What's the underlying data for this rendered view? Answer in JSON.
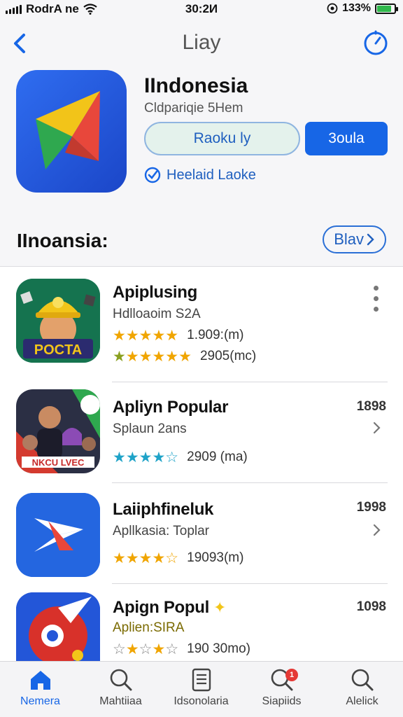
{
  "status_bar": {
    "carrier": "RodrA ne",
    "time": "30:2И",
    "battery": "133%"
  },
  "nav": {
    "title": "Liay"
  },
  "hero": {
    "name": "IIndonesia",
    "subtitle": "Cldpariqie 5Hem",
    "install_label": "Raoku ly",
    "open_label": "3oula",
    "verified_label": "Heelaid Laoke"
  },
  "section": {
    "title": "IInoansia:",
    "button_label": "Blav"
  },
  "apps": [
    {
      "name": "Apiplusing",
      "subtitle": "Hdlloaoim S2A",
      "rating_text_1": "1.909:(m)",
      "rating_text_2": "2905(mc)",
      "right_label": "",
      "stars_1": 5,
      "stars_2": 5
    },
    {
      "name": "Apliyn Popular",
      "subtitle": "Splaun 2ans",
      "rating_text_1": "2909 (ma)",
      "right_label": "1898",
      "stars_1": 4.5
    },
    {
      "name": "Laiiphfineluk",
      "subtitle": "Apllkasia: Toplar",
      "rating_text_1": "19093(m)",
      "right_label": "1998",
      "stars_1": 4.5
    },
    {
      "name": "Apign Popul",
      "subtitle": "Aplien:SIRA",
      "rating_text_1": "190 30mo)",
      "right_label": "1098",
      "stars_1": 2.5
    }
  ],
  "tabs": [
    {
      "label": "Nemera"
    },
    {
      "label": "Mahtiiaa"
    },
    {
      "label": "Idsonolaria"
    },
    {
      "label": "Siapiids",
      "badge": "1"
    },
    {
      "label": "Alelick"
    }
  ],
  "colors": {
    "accent": "#1766e6",
    "star_gold": "#f0a500",
    "star_teal": "#1fa3c8",
    "badge": "#e53935"
  }
}
